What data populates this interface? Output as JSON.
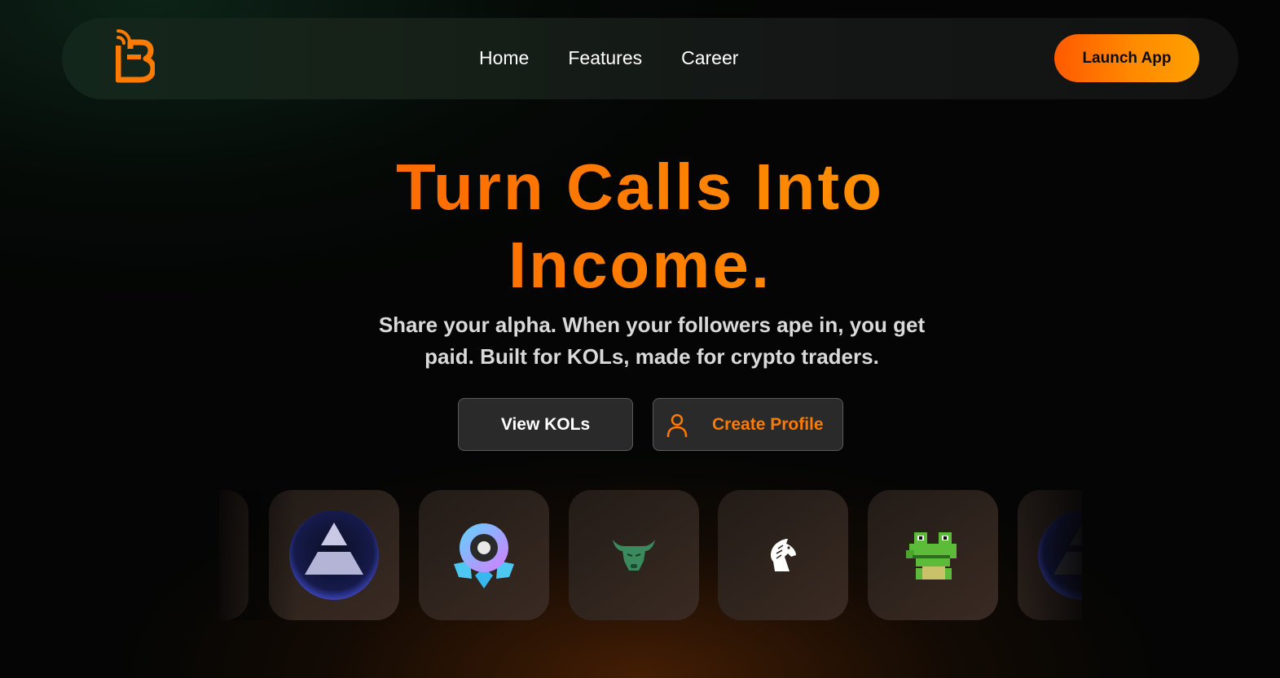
{
  "nav": {
    "logo_icon": "broadcast-b-logo-icon",
    "links": [
      "Home",
      "Features",
      "Career"
    ],
    "launch_label": "Launch App"
  },
  "hero": {
    "title_line1": "Turn Calls Into",
    "title_line2": "Income.",
    "subtitle_line1": "Share your alpha. When your followers ape in, you get",
    "subtitle_line2": "paid. Built for KOLs, made for crypto traders."
  },
  "actions": {
    "view_kols": "View KOLs",
    "create_profile": "Create Profile",
    "create_profile_icon": "user-icon"
  },
  "carousel": {
    "items": [
      "pyramid-token-icon",
      "rocket-orb-token-icon",
      "bull-token-icon",
      "horse-knight-token-icon",
      "pixel-frog-token-icon"
    ]
  },
  "colors": {
    "accent": "#ff7a00",
    "accent_gradient_start": "#ff5a00",
    "accent_gradient_end": "#ffa000",
    "background": "#040504"
  }
}
